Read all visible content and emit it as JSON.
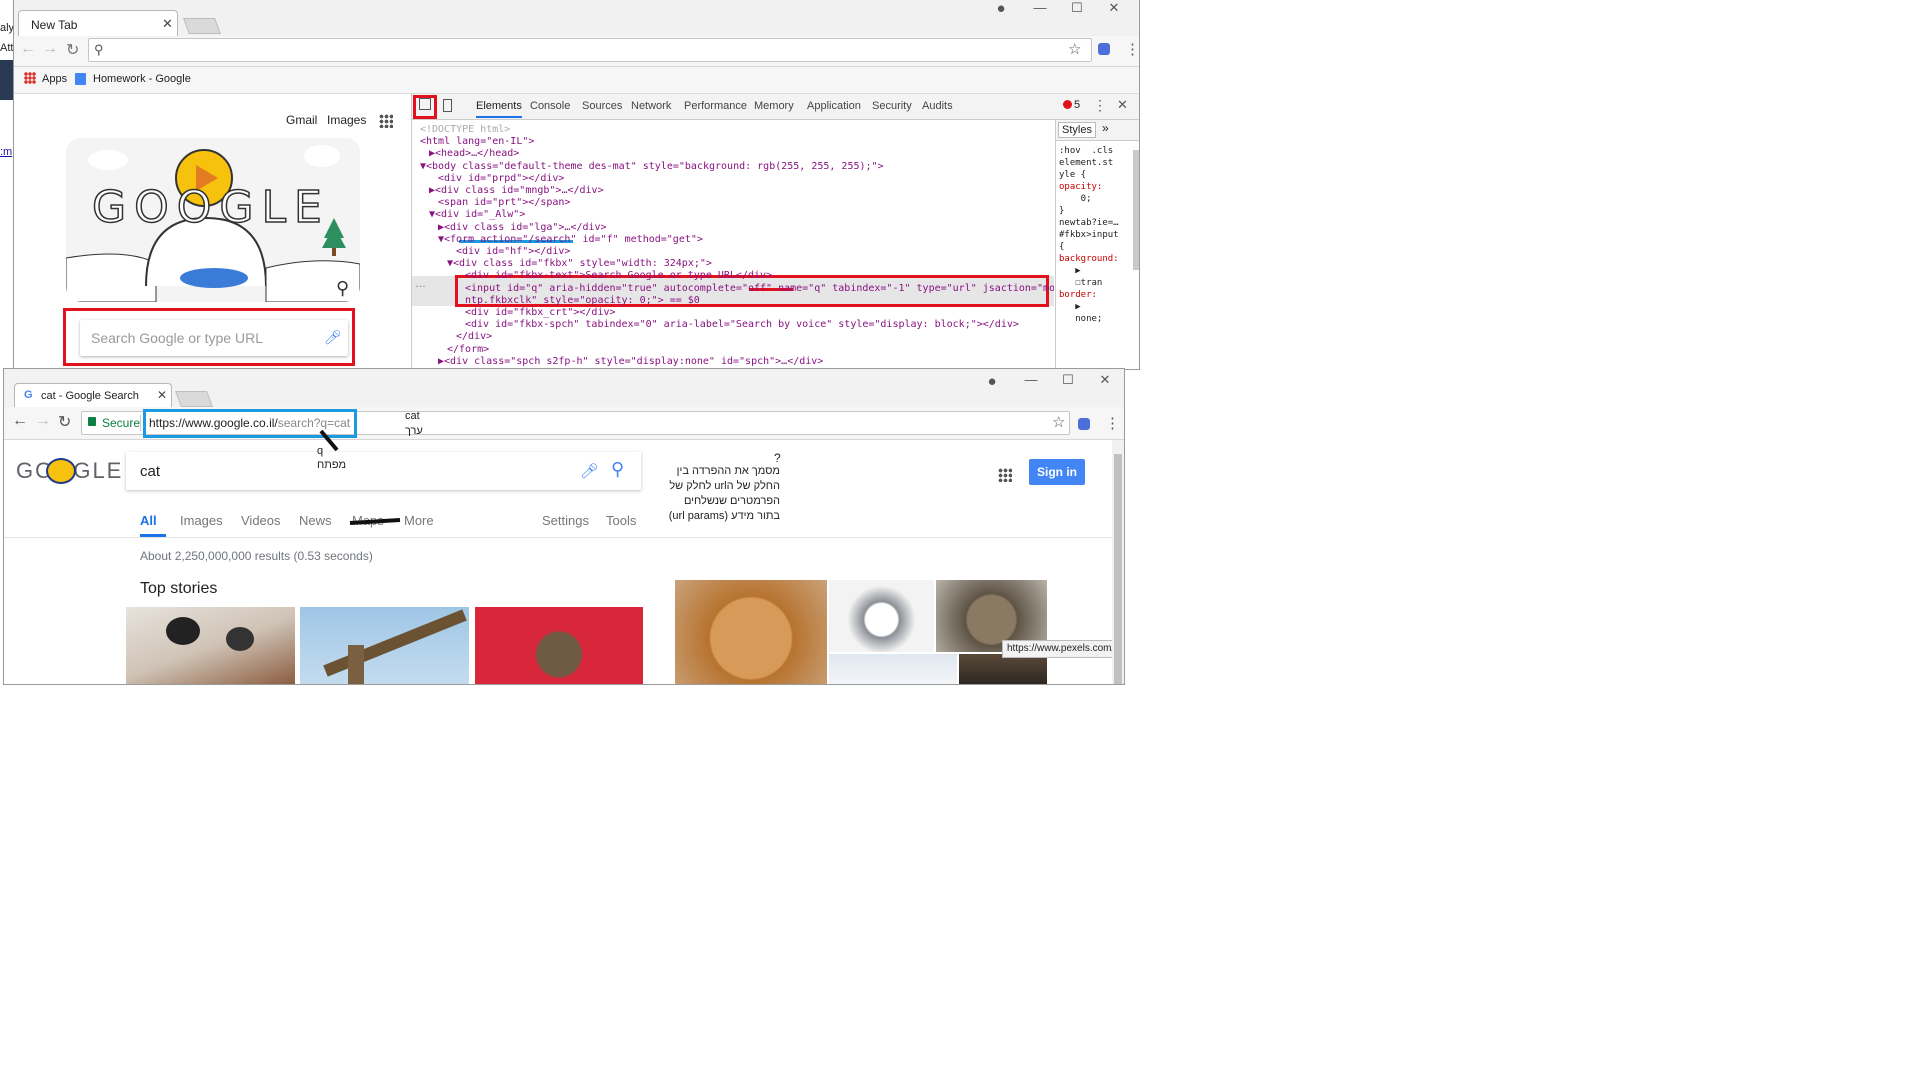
{
  "top_window": {
    "tab_title": "New Tab",
    "left_edge_fragments": [
      "aly",
      "Att",
      ":m"
    ],
    "bookmarks": [
      {
        "label": "Apps"
      },
      {
        "label": "Homework - Google"
      }
    ],
    "ntp": {
      "gmail": "Gmail",
      "images": "Images",
      "doodle_letters": "GOOGLE",
      "search_placeholder": "Search Google or type URL"
    },
    "devtools": {
      "tabs": [
        "Elements",
        "Console",
        "Sources",
        "Network",
        "Performance",
        "Memory",
        "Application",
        "Security",
        "Audits"
      ],
      "error_count": "5",
      "code_lines": [
        {
          "indent": 0,
          "text": "<!DOCTYPE html>"
        },
        {
          "indent": 0,
          "text": "<html lang=\"en-IL\">"
        },
        {
          "indent": 1,
          "text": "▶<head>…</head>"
        },
        {
          "indent": 0,
          "text": "▼<body class=\"default-theme des-mat\" style=\"background: rgb(255, 255, 255);\">"
        },
        {
          "indent": 2,
          "text": "<div id=\"prpd\"></div>"
        },
        {
          "indent": 1,
          "text": "▶<div class id=\"mngb\">…</div>"
        },
        {
          "indent": 2,
          "text": "<span id=\"prt\"></span>"
        },
        {
          "indent": 1,
          "text": "▼<div id=\"_Alw\">"
        },
        {
          "indent": 2,
          "text": "▶<div class id=\"lga\">…</div>"
        },
        {
          "indent": 2,
          "text": "▼<form action=\"/search\" id=\"f\" method=\"get\">"
        },
        {
          "indent": 4,
          "text": "<div id=\"hf\"></div>"
        },
        {
          "indent": 3,
          "text": "▼<div class id=\"fkbx\" style=\"width: 324px;\">"
        },
        {
          "indent": 5,
          "text": "<div id=\"fkbx-text\">Search Google or type URL</div>"
        },
        {
          "indent": 5,
          "text": "<input id=\"q\" aria-hidden=\"true\" autocomplete=\"off\" name=\"q\" tabindex=\"-1\" type=\"url\" jsaction=\"mousedown:"
        },
        {
          "indent": 5,
          "text": "ntp.fkbxclk\" style=\"opacity: 0;\"> == $0"
        },
        {
          "indent": 5,
          "text": "<div id=\"fkbx_crt\"></div>"
        },
        {
          "indent": 5,
          "text": "<div id=\"fkbx-spch\" tabindex=\"0\" aria-label=\"Search by voice\" style=\"display: block;\"></div>"
        },
        {
          "indent": 4,
          "text": "</div>"
        },
        {
          "indent": 3,
          "text": "</form>"
        },
        {
          "indent": 2,
          "text": "▶<div class=\"spch s2fp-h\" style=\"display:none\" id=\"spch\">…</div>"
        }
      ],
      "styles_tab": "Styles",
      "styles_lines": [
        ":hov  .cls",
        "element.st",
        "yle {",
        "opacity:",
        "    0;",
        "}",
        "newtab?ie=…",
        "#fkbx>input",
        "{",
        "background:",
        "   ▶",
        "   ☐tran",
        "border:",
        "   ▶",
        "   none;"
      ]
    }
  },
  "bottom_window": {
    "tab_title": "cat - Google Search",
    "secure_label": "Secure",
    "url_main": "https://www.google.co.il/",
    "url_rest": "search?q=cat",
    "logo_text": "GOOGLE",
    "search_value": "cat",
    "sign_in": "Sign in",
    "tabs": [
      "All",
      "Images",
      "Videos",
      "News",
      "Maps",
      "More"
    ],
    "tools": [
      "Settings",
      "Tools"
    ],
    "results_count": "About 2,250,000,000 results (0.53 seconds)",
    "top_stories": "Top stories",
    "tooltip_url": "https://www.pexels.com/se"
  },
  "annotations": {
    "value_word": "cat",
    "value_label": "ערך",
    "key_word": "q",
    "key_label": "מפתח",
    "question_mark": "?",
    "question_lines": [
      "מסמך את ההפרדה בין",
      "החלק של הurl לחלק של",
      "הפרמטרים שנשלחים",
      "בתור מידע (url params)"
    ]
  },
  "colors": {
    "annotation_red": "#e1111e",
    "annotation_blue": "#1a9ae0",
    "google_blue": "#4285f4"
  }
}
